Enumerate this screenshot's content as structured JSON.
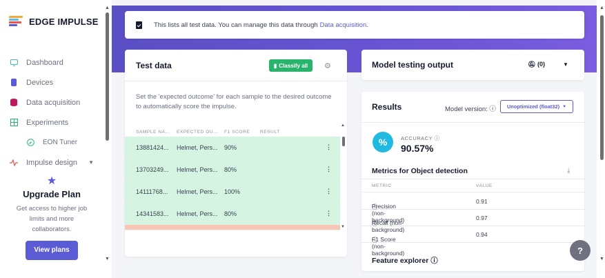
{
  "app": {
    "brand": "EDGE IMPULSE"
  },
  "sidebar": {
    "items": [
      {
        "label": "Dashboard",
        "icon": "monitor-icon"
      },
      {
        "label": "Devices",
        "icon": "chip-icon"
      },
      {
        "label": "Data acquisition",
        "icon": "database-icon"
      },
      {
        "label": "Experiments",
        "icon": "grid-icon"
      },
      {
        "label": "EON Tuner",
        "icon": "compass-icon"
      },
      {
        "label": "Impulse design",
        "icon": "pulse-icon"
      }
    ],
    "upgrade": {
      "title": "Upgrade Plan",
      "text": "Get access to higher job limits and more collaborators.",
      "button": "View plans"
    }
  },
  "banner": {
    "text": "This lists all test data. You can manage this data through",
    "link": "Data acquisition",
    "suffix": "."
  },
  "test_data": {
    "title": "Test data",
    "classify_button": "Classify all",
    "description": "Set the 'expected outcome' for each sample to the desired outcome to automatically score the impulse.",
    "columns": [
      "SAMPLE NA...",
      "EXPECTED OU...",
      "F1 SCORE",
      "RESULT"
    ],
    "rows": [
      {
        "sample": "13881424...",
        "expected": "Helmet, Pers...",
        "f1": "90%"
      },
      {
        "sample": "13703249...",
        "expected": "Helmet, Pers...",
        "f1": "80%"
      },
      {
        "sample": "14111768...",
        "expected": "Helmet, Pers...",
        "f1": "100%"
      },
      {
        "sample": "14341583...",
        "expected": "Helmet, Pers...",
        "f1": "80%"
      }
    ]
  },
  "model_output": {
    "title": "Model testing output",
    "notifications": "(0)"
  },
  "results": {
    "title": "Results",
    "model_version_label": "Model version: ",
    "model_version_value": "Unoptimized (float32)",
    "accuracy_label": "ACCURACY",
    "accuracy_value": "90.57%",
    "metrics_title": "Metrics for Object detection",
    "metric_columns": [
      "METRIC",
      "VALUE"
    ],
    "metrics": [
      {
        "name": "Precision (non-background)",
        "value": "0.91"
      },
      {
        "name": "Recall (non-background)",
        "value": "0.97"
      },
      {
        "name": "F1 Score (non-background)",
        "value": "0.94"
      }
    ],
    "feature_explorer": "Feature explorer"
  },
  "colors": {
    "accent": "#5b5bd6",
    "success": "#29b36b",
    "banner": "#6a55d4",
    "accuracy_badge": "#20b9e0"
  }
}
